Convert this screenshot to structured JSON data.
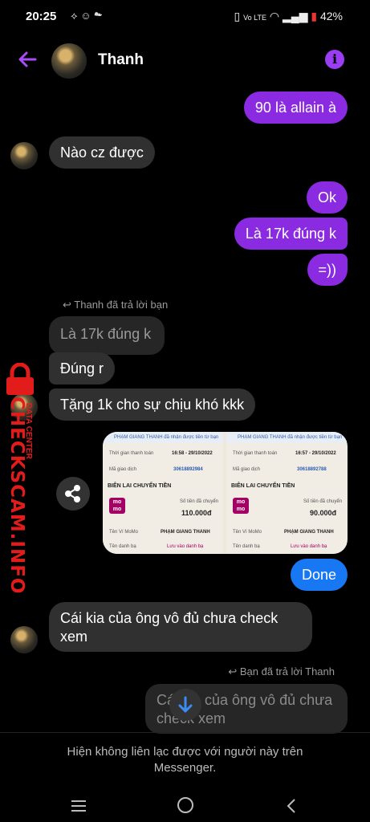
{
  "status": {
    "time": "20:25",
    "battery": "42%",
    "net": "Vo LTE"
  },
  "header": {
    "name": "Thanh"
  },
  "messages": {
    "m1": "90 là allain à",
    "m2": "Nào cz được",
    "m3": "Ok",
    "m4": "Là 17k đúng k",
    "m5": "=))",
    "reply1": "Thanh đã trả lời bạn",
    "quote1": "Là 17k đúng k",
    "m6": "Đúng r",
    "m7": "Tặng 1k cho sự chịu khó kkk",
    "done": "Done",
    "m8a": "Cái kia của ông vô đủ chưa check",
    "m8b": "xem",
    "reply2": "Bạn đã trả lời Thanh",
    "quote2a": "Cái kia của ông vô đủ chưa",
    "quote2b": "check xem"
  },
  "receipts": {
    "left": {
      "banner": "PHẠM GIANG THANH đã nhận được tiền từ bạn",
      "time_label": "Thời gian thanh toán",
      "time": "16:58 - 29/10/2022",
      "code_label": "Mã giao dịch",
      "code": "30618892984",
      "title": "BIÊN LAI CHUYỂN TIỀN",
      "amount_label": "Số tiền đã chuyển",
      "amount": "110.000đ",
      "name_label": "Tên Ví MoMo",
      "name": "PHẠM GIANG THANH",
      "contact_label": "Tên danh bạ",
      "contact": "Lưu vào danh bạ"
    },
    "right": {
      "banner": "PHẠM GIANG THANH đã nhận được tiền từ bạn",
      "time_label": "Thời gian thanh toán",
      "time": "16:57 - 29/10/2022",
      "code_label": "Mã giao dịch",
      "code": "30618892788",
      "title": "BIÊN LAI CHUYỂN TIỀN",
      "amount_label": "Số tiền đã chuyển",
      "amount": "90.000đ",
      "name_label": "Tên Ví MoMo",
      "name": "PHẠM GIANG THANH",
      "contact_label": "Tên danh bạ",
      "contact": "Lưu vào danh bạ"
    },
    "logo_text": "mo mo"
  },
  "watermark": {
    "main": "CHECKSCAM.INFO",
    "sub": "DATA CENTER"
  },
  "footer": {
    "line1": "Hiện không liên lạc được với người này trên",
    "line2": "Messenger."
  },
  "colors": {
    "accent": "#8a2be2",
    "done": "#1877f2",
    "incoming": "#303030",
    "watermark": "#e21b1b"
  }
}
